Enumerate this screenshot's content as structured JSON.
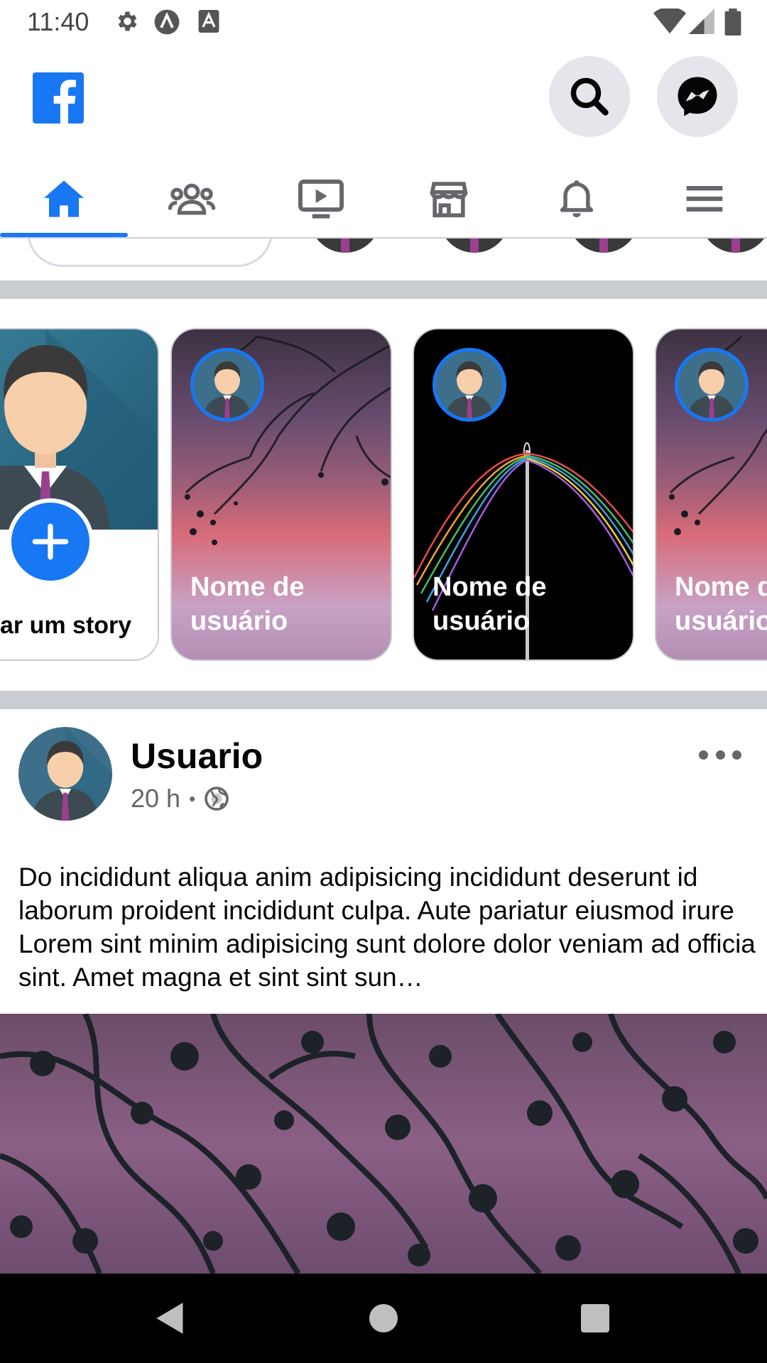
{
  "status_bar": {
    "time": "11:40",
    "icons": [
      "gear-icon",
      "a-circle-icon",
      "a-box-icon"
    ],
    "right_icons": [
      "wifi-icon",
      "cell-signal-icon",
      "battery-icon"
    ]
  },
  "header": {
    "logo": "facebook-logo",
    "buttons": [
      "search-icon",
      "messenger-icon"
    ]
  },
  "tabs": [
    {
      "name": "home",
      "icon": "home-icon",
      "active": true
    },
    {
      "name": "friends",
      "icon": "friends-icon",
      "active": false
    },
    {
      "name": "watch",
      "icon": "watch-icon",
      "active": false
    },
    {
      "name": "marketplace",
      "icon": "marketplace-icon",
      "active": false
    },
    {
      "name": "notifications",
      "icon": "bell-icon",
      "active": false
    },
    {
      "name": "menu",
      "icon": "menu-icon",
      "active": false
    }
  ],
  "stories": {
    "create_label": "ar um story",
    "items": [
      {
        "name": "Nome de usuário",
        "background": "twilight-branches"
      },
      {
        "name": "Nome de usuário",
        "background": "black-needle-threads"
      },
      {
        "name": "Nome de usuário",
        "background": "twilight-branches"
      }
    ]
  },
  "post": {
    "user": "Usuario",
    "time": "20 h",
    "separator": "•",
    "privacy_icon": "globe-icon",
    "text": "Do incididunt aliqua anim adipisicing incididunt deserunt id laborum proident incididunt culpa. Aute pariatur eiusmod irure Lorem sint minim adipisicing sunt dolore dolor veniam ad officia sint. Amet magna et sint sint sun…"
  },
  "colors": {
    "accent": "#1877f2",
    "divider": "#c9ccd1",
    "secondary_text": "#65676b"
  }
}
